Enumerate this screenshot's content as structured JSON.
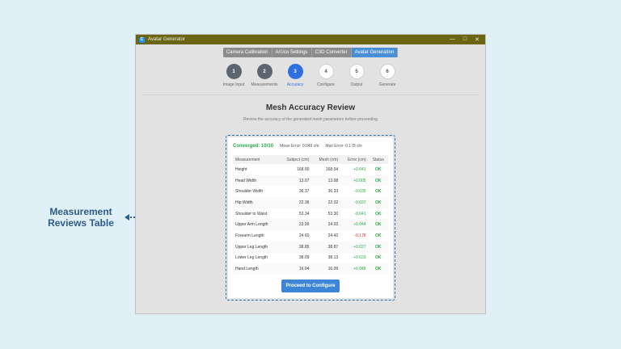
{
  "annotation": {
    "line1": "Measurement",
    "line2": "Reviews Table"
  },
  "window": {
    "title": "Avatar Generator",
    "icon": "C",
    "controls": [
      "—",
      "□",
      "✕"
    ]
  },
  "tabs": [
    {
      "label": "Camera Calibration",
      "active": false
    },
    {
      "label": "ArUco Settings",
      "active": false
    },
    {
      "label": "C3D Converter",
      "active": false
    },
    {
      "label": "Avatar Generation",
      "active": true
    }
  ],
  "steps": [
    {
      "num": "1",
      "label": "Image Input",
      "state": "done"
    },
    {
      "num": "2",
      "label": "Measurements",
      "state": "done"
    },
    {
      "num": "3",
      "label": "Accuracy",
      "state": "current"
    },
    {
      "num": "4",
      "label": "Configure",
      "state": "todo"
    },
    {
      "num": "5",
      "label": "Output",
      "state": "todo"
    },
    {
      "num": "6",
      "label": "Generate",
      "state": "todo"
    }
  ],
  "page": {
    "title": "Mesh Accuracy Review",
    "subtitle": "Review the accuracy of the generated mesh parameters before proceeding"
  },
  "summary": {
    "converged": "Converged: 10/10",
    "mean_error": "Mean Error: 0.049 cm",
    "max_error": "Max Error: 0.178 cm"
  },
  "table": {
    "headers": [
      "Measurement",
      "Subject (cm)",
      "Mesh (cm)",
      "Error (cm)",
      "Status"
    ],
    "rows": [
      [
        "Height",
        "168.00",
        "168.04",
        "+0.041",
        "OK"
      ],
      [
        "Head Width",
        "13.07",
        "13.08",
        "+0.005",
        "OK"
      ],
      [
        "Shoulder Width",
        "36.37",
        "36.33",
        "-0.035",
        "OK"
      ],
      [
        "Hip Width",
        "22.36",
        "22.32",
        "-0.037",
        "OK"
      ],
      [
        "Shoulder to Waist",
        "53.34",
        "53.30",
        "-0.041",
        "OK"
      ],
      [
        "Upper Arm Length",
        "23.99",
        "24.03",
        "+0.044",
        "OK"
      ],
      [
        "Forearm Length",
        "24.60",
        "24.42",
        "-0.178",
        "OK"
      ],
      [
        "Upper Leg Length",
        "38.85",
        "38.87",
        "+0.027",
        "OK"
      ],
      [
        "Lower Leg Length",
        "38.09",
        "38.13",
        "+0.033",
        "OK"
      ],
      [
        "Hand Length",
        "16.04",
        "16.09",
        "+0.048",
        "OK"
      ]
    ]
  },
  "proceed_label": "Proceed to Configure",
  "colors": {
    "accent": "#2f6fe0",
    "ok": "#28a745",
    "warn": "#dd3333",
    "titlebar": "#6b6512"
  }
}
